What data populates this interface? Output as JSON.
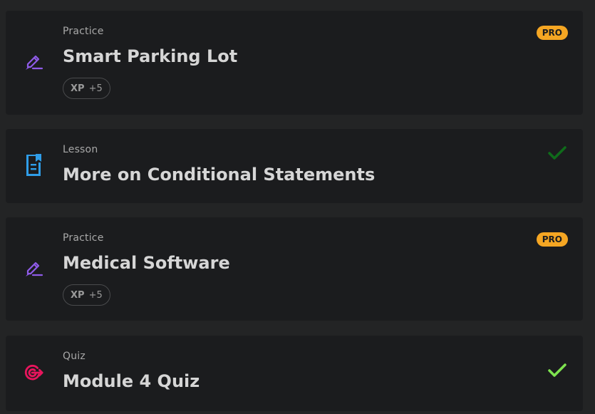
{
  "items": [
    {
      "type": "Practice",
      "title": "Smart Parking Lot",
      "icon": "pencil-icon",
      "badge": "PRO",
      "xp_label": "XP",
      "xp_value": "+5"
    },
    {
      "type": "Lesson",
      "title": "More on Conditional Statements",
      "icon": "lesson-document-icon",
      "status": "completed",
      "check_color": "#0f6b1a"
    },
    {
      "type": "Practice",
      "title": "Medical Software",
      "icon": "pencil-icon",
      "badge": "PRO",
      "xp_label": "XP",
      "xp_value": "+5"
    },
    {
      "type": "Quiz",
      "title": "Module 4 Quiz",
      "icon": "target-icon",
      "status": "completed",
      "check_color": "#7ee34f"
    }
  ],
  "colors": {
    "practice_icon": "#8f5be8",
    "lesson_icon": "#2f9de8",
    "quiz_icon": "#e8155d",
    "pro_badge": "#f5a623"
  }
}
